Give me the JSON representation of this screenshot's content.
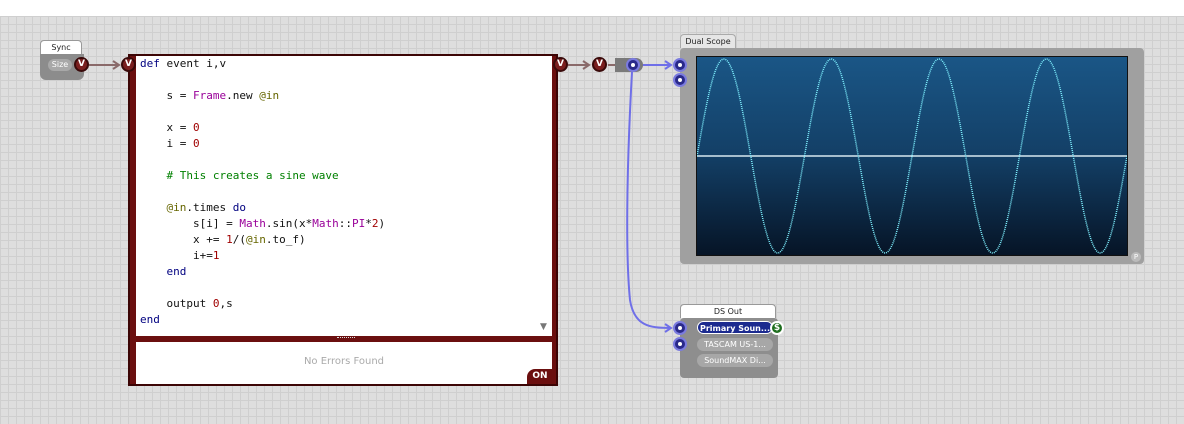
{
  "sync": {
    "title": "Sync",
    "size_label": "Size",
    "output_port": "V"
  },
  "ruby": {
    "input_port": "V",
    "output_port": "V",
    "code": [
      [
        {
          "t": "def",
          "c": "kw"
        },
        {
          "t": " event i,v",
          "c": ""
        }
      ],
      [],
      [
        {
          "t": "    s = ",
          "c": ""
        },
        {
          "t": "Frame",
          "c": "cls"
        },
        {
          "t": ".new ",
          "c": ""
        },
        {
          "t": "@in",
          "c": "ivar"
        }
      ],
      [],
      [
        {
          "t": "    x = ",
          "c": ""
        },
        {
          "t": "0",
          "c": "num"
        }
      ],
      [
        {
          "t": "    i = ",
          "c": ""
        },
        {
          "t": "0",
          "c": "num"
        }
      ],
      [],
      [
        {
          "t": "    # This creates a sine wave",
          "c": "cmt"
        }
      ],
      [],
      [
        {
          "t": "    ",
          "c": ""
        },
        {
          "t": "@in",
          "c": "ivar"
        },
        {
          "t": ".times ",
          "c": ""
        },
        {
          "t": "do",
          "c": "kw"
        }
      ],
      [
        {
          "t": "        s[i] = ",
          "c": ""
        },
        {
          "t": "Math",
          "c": "cls"
        },
        {
          "t": ".sin(x*",
          "c": ""
        },
        {
          "t": "Math",
          "c": "cls"
        },
        {
          "t": "::",
          "c": ""
        },
        {
          "t": "PI",
          "c": "cls"
        },
        {
          "t": "*",
          "c": ""
        },
        {
          "t": "2",
          "c": "num"
        },
        {
          "t": ")",
          "c": ""
        }
      ],
      [
        {
          "t": "        x += ",
          "c": ""
        },
        {
          "t": "1",
          "c": "num"
        },
        {
          "t": "/(",
          "c": ""
        },
        {
          "t": "@in",
          "c": "ivar"
        },
        {
          "t": ".to_f)",
          "c": ""
        }
      ],
      [
        {
          "t": "        i+=",
          "c": ""
        },
        {
          "t": "1",
          "c": "num"
        }
      ],
      [
        {
          "t": "    ",
          "c": ""
        },
        {
          "t": "end",
          "c": "kw"
        }
      ],
      [],
      [
        {
          "t": "    output ",
          "c": ""
        },
        {
          "t": "0",
          "c": "num"
        },
        {
          "t": ",s",
          "c": ""
        }
      ],
      [
        {
          "t": "end",
          "c": "kw"
        }
      ]
    ],
    "status": "No Errors Found",
    "toggle": "ON"
  },
  "connector": {
    "port": "V"
  },
  "scope": {
    "title": "Dual Scope",
    "corner_badge": "P",
    "signal": {
      "cycles": 4,
      "amplitude": 1.0
    },
    "colors": {
      "trace": "#7ff0ff",
      "zero_line": "#d8e8f0"
    }
  },
  "dsout": {
    "title": "DS Out",
    "devices": [
      "Primary Soun...",
      "TASCAM US-1...",
      "SoundMAX Di..."
    ],
    "badge": "$"
  }
}
